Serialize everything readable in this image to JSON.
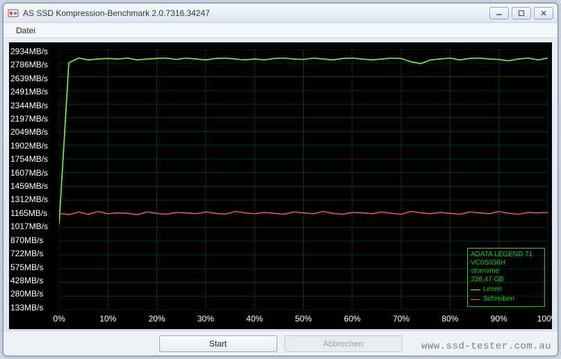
{
  "window": {
    "title": "AS SSD Kompression-Benchmark 2.0.7316.34247"
  },
  "menu": {
    "file": "Datei"
  },
  "buttons": {
    "start": "Start",
    "cancel": "Abbrechen"
  },
  "legend": {
    "device": "ADATA LEGEND 71",
    "firmware": "VC0S036H",
    "driver": "stornvme",
    "capacity": "238,47 GB",
    "read_label": "Lesen",
    "write_label": "Schreiben",
    "read_color": "#6cff3c",
    "write_color": "#ff5a5a"
  },
  "watermark": "www.ssd-tester.com.au",
  "chart_data": {
    "type": "line",
    "title": "",
    "xlabel": "",
    "ylabel": "",
    "y_unit": "MB/s",
    "x_unit": "%",
    "xlim": [
      0,
      100
    ],
    "ylim": [
      133,
      2934
    ],
    "x_ticks": [
      0,
      10,
      20,
      30,
      40,
      50,
      60,
      70,
      80,
      90,
      100
    ],
    "x_tick_labels": [
      "0%",
      "10%",
      "20%",
      "30%",
      "40%",
      "50%",
      "60%",
      "70%",
      "80%",
      "90%",
      "100%"
    ],
    "y_ticks": [
      2934,
      2786,
      2639,
      2491,
      2344,
      2197,
      2049,
      1902,
      1754,
      1607,
      1459,
      1312,
      1165,
      1017,
      870,
      722,
      575,
      428,
      280,
      133
    ],
    "y_tick_labels": [
      "2934MB/s",
      "2786MB/s",
      "2639MB/s",
      "2491MB/s",
      "2344MB/s",
      "2197MB/s",
      "2049MB/s",
      "1902MB/s",
      "1754MB/s",
      "1607MB/s",
      "1459MB/s",
      "1312MB/s",
      "1165MB/s",
      "1017MB/s",
      "870MB/s",
      "722MB/s",
      "575MB/s",
      "428MB/s",
      "280MB/s",
      "133MB/s"
    ],
    "x": [
      0,
      2,
      4,
      6,
      8,
      10,
      12,
      14,
      16,
      18,
      20,
      22,
      24,
      26,
      28,
      30,
      32,
      34,
      36,
      38,
      40,
      42,
      44,
      46,
      48,
      50,
      52,
      54,
      56,
      58,
      60,
      62,
      64,
      66,
      68,
      70,
      72,
      74,
      76,
      78,
      80,
      82,
      84,
      86,
      88,
      90,
      92,
      94,
      96,
      98,
      100
    ],
    "series": [
      {
        "name": "Lesen",
        "color": "#6cff3c",
        "values": [
          1050,
          2790,
          2840,
          2820,
          2830,
          2835,
          2830,
          2840,
          2820,
          2830,
          2835,
          2840,
          2825,
          2840,
          2830,
          2820,
          2835,
          2840,
          2830,
          2820,
          2830,
          2820,
          2835,
          2840,
          2830,
          2825,
          2840,
          2830,
          2820,
          2835,
          2840,
          2830,
          2820,
          2830,
          2840,
          2835,
          2800,
          2780,
          2820,
          2830,
          2840,
          2820,
          2835,
          2840,
          2830,
          2825,
          2810,
          2830,
          2840,
          2820,
          2840
        ]
      },
      {
        "name": "Schreiben",
        "color": "#ff5a5a",
        "values": [
          1170,
          1155,
          1185,
          1160,
          1190,
          1165,
          1175,
          1170,
          1155,
          1185,
          1170,
          1160,
          1180,
          1175,
          1165,
          1185,
          1170,
          1160,
          1190,
          1175,
          1165,
          1180,
          1170,
          1160,
          1185,
          1175,
          1165,
          1190,
          1170,
          1160,
          1180,
          1175,
          1165,
          1185,
          1170,
          1160,
          1190,
          1175,
          1165,
          1180,
          1170,
          1160,
          1185,
          1175,
          1165,
          1190,
          1170,
          1160,
          1180,
          1175,
          1180
        ]
      }
    ]
  }
}
